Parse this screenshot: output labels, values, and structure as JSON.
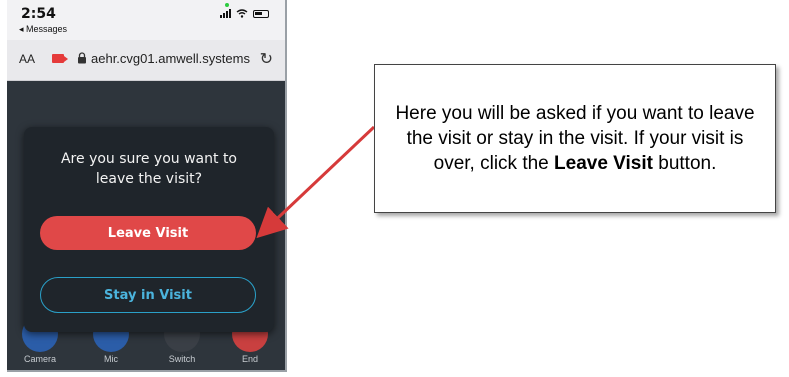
{
  "status_bar": {
    "time": "2:54",
    "back_label": "◂ Messages"
  },
  "browser": {
    "text_size_label": "AA",
    "url": "aehr.cvg01.amwell.systems",
    "reload_icon": "reload-icon"
  },
  "dialog": {
    "title": "Are you sure you want to leave the visit?",
    "leave_label": "Leave Visit",
    "stay_label": "Stay in Visit"
  },
  "controls": [
    {
      "label": "Camera",
      "color": "#2b5da8"
    },
    {
      "label": "Mic",
      "color": "#2b5da8"
    },
    {
      "label": "Switch",
      "color": "#3a3f46"
    },
    {
      "label": "End",
      "color": "#c94040"
    }
  ],
  "callout": {
    "text_before": "Here you will be asked if you want to leave the visit or stay in the visit.  If your visit is over, click the ",
    "bold": "Leave Visit",
    "text_after": " button."
  },
  "colors": {
    "leave_button": "#e04848",
    "stay_border": "#2aa0c8",
    "arrow": "#d63a3a"
  }
}
